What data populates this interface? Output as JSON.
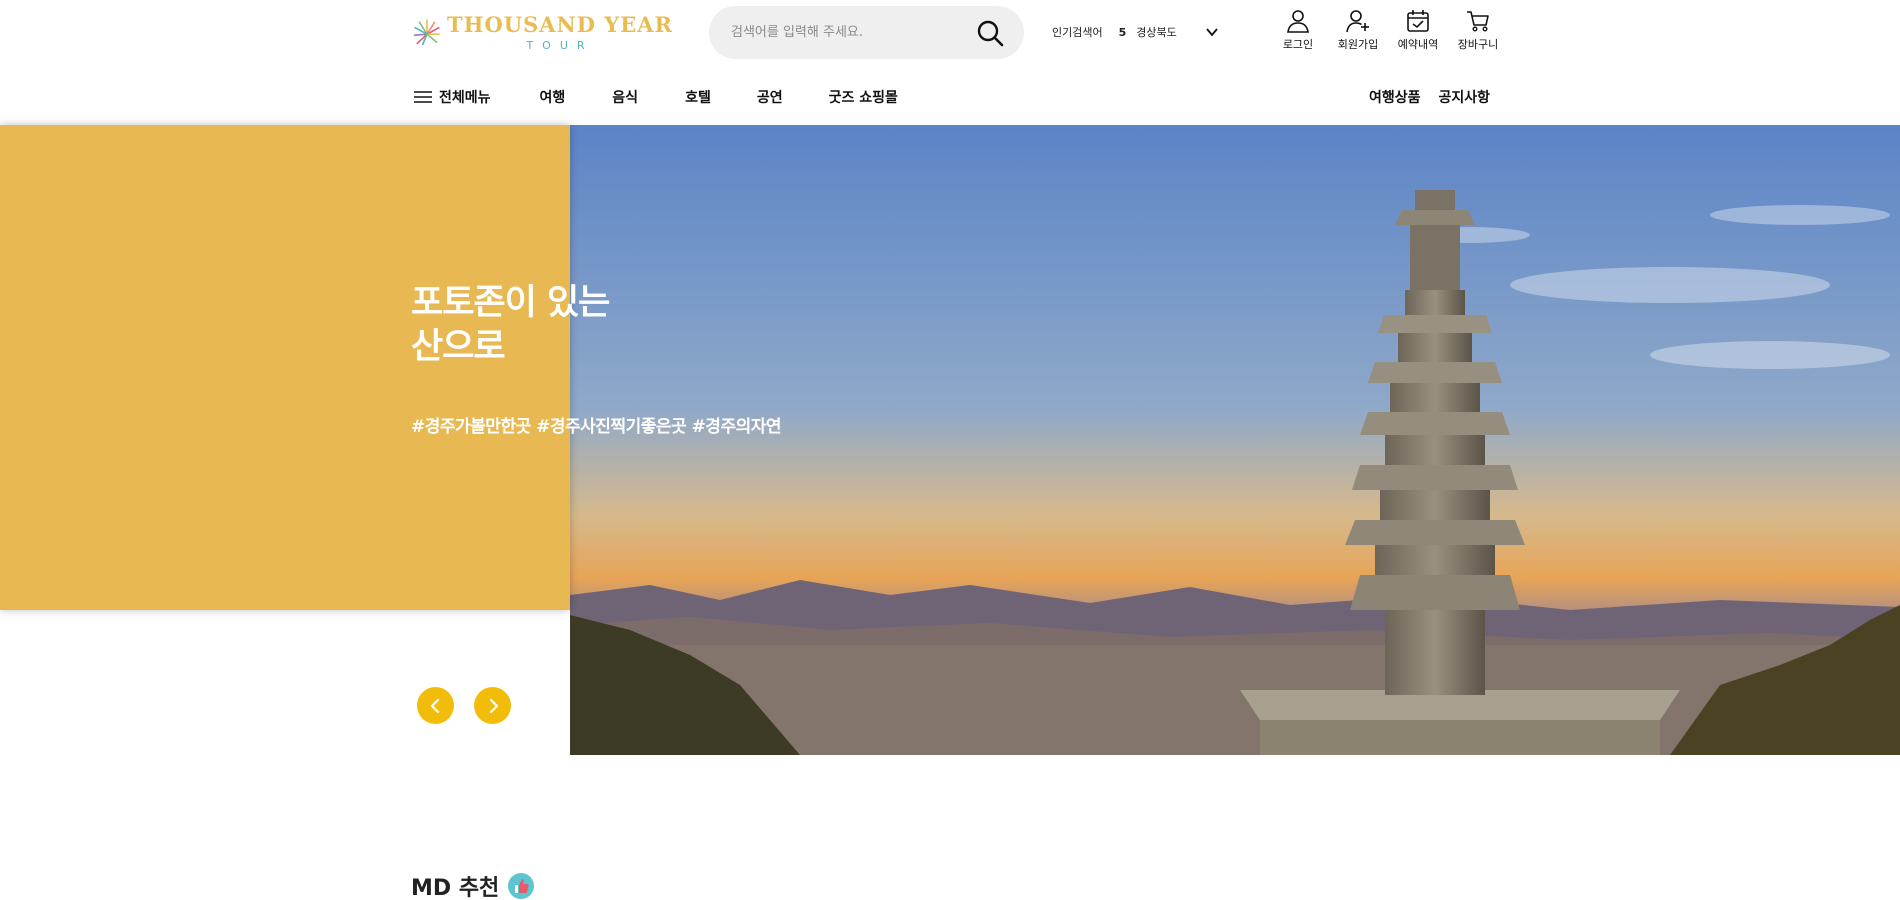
{
  "brand": {
    "title": "THOUSAND YEAR",
    "subtitle": "TOUR",
    "colors": {
      "gold": "#e9bc52",
      "teal": "#4fb6c1"
    }
  },
  "search": {
    "placeholder": "검색어를 입력해 주세요.",
    "value": "",
    "icon": "search-icon"
  },
  "popular": {
    "label": "인기검색어",
    "rank": "5",
    "keyword": "경상북도",
    "icon": "chevron-down-icon"
  },
  "user_menu": [
    {
      "label": "로그인",
      "icon": "user-icon"
    },
    {
      "label": "회원가입",
      "icon": "user-plus-icon"
    },
    {
      "label": "예약내역",
      "icon": "calendar-check-icon"
    },
    {
      "label": "장바구니",
      "icon": "cart-icon"
    }
  ],
  "nav": {
    "all_menu": "전체메뉴",
    "items": [
      "여행",
      "음식",
      "호텔",
      "공연",
      "굿즈 쇼핑몰"
    ],
    "right": [
      "여행상품",
      "공지사항"
    ]
  },
  "hero": {
    "title_line1": "포토존이 있는",
    "title_line2": "산으로",
    "tags": "#경주가볼만한곳 #경주사진찍기좋은곳 #경주의자연",
    "panel_color": "#e8b952",
    "button_color": "#f2bd0a",
    "prev_icon": "chevron-left-icon",
    "next_icon": "chevron-right-icon"
  },
  "section": {
    "title": "MD 추천",
    "icon": "thumbs-up-icon"
  }
}
